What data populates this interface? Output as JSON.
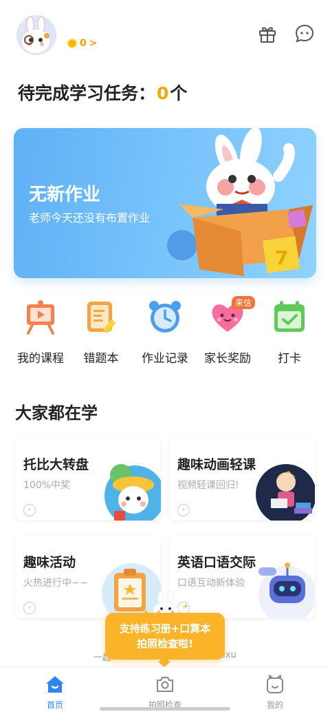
{
  "header": {
    "coin_count": "0",
    "coin_chevron": ">"
  },
  "tasks": {
    "prefix": "待完成学习任务：",
    "count": "0",
    "suffix": "个"
  },
  "banner": {
    "title": "无新作业",
    "subtitle": "老师今天还没有布置作业",
    "art_digit": "7"
  },
  "quick_actions": [
    {
      "label": "我的课程",
      "icon": "easel-video-icon"
    },
    {
      "label": "错题本",
      "icon": "notebook-icon"
    },
    {
      "label": "作业记录",
      "icon": "clock-icon"
    },
    {
      "label": "家长奖励",
      "icon": "heart-face-icon",
      "badge": "来信"
    },
    {
      "label": "打卡",
      "icon": "calendar-check-icon"
    }
  ],
  "section": {
    "title": "大家都在学"
  },
  "cards": [
    {
      "title": "托比大转盘",
      "subtitle": "100%中奖"
    },
    {
      "title": "趣味动画轻课",
      "subtitle": "视频轻课回归!"
    },
    {
      "title": "趣味活动",
      "subtitle": "火热进行中~~"
    },
    {
      "title": "英语口语交际",
      "subtitle": "口语互动新体验"
    }
  ],
  "footer": {
    "left_text": "一起",
    "right_text": "exu"
  },
  "tooltip": {
    "line1": "支持练习册+口算本",
    "line2": "拍照检查啦!"
  },
  "tabbar": [
    {
      "label": "首页",
      "active": true
    },
    {
      "label": "拍照检查",
      "active": false
    },
    {
      "label": "我的",
      "active": false
    }
  ],
  "colors": {
    "accent": "#2f84f0",
    "highlight": "#f5a800",
    "banner": "#6bbaf8",
    "tooltip": "#fbb42a"
  }
}
